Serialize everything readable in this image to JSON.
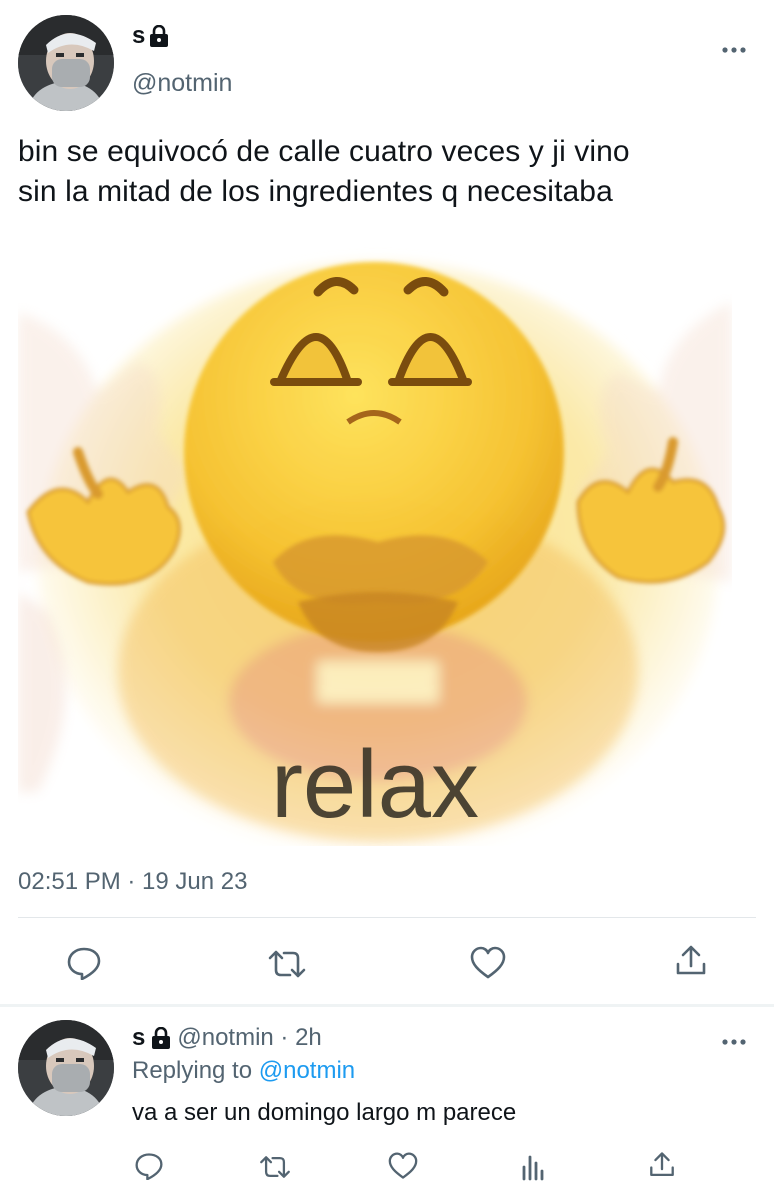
{
  "main_tweet": {
    "display_name": "s",
    "handle": "@notmin",
    "text_line1": "bin se equivocó de calle cuatro veces y ji vino",
    "text_line2": "sin la mitad de los ingredientes q necesitaba",
    "image_text": "relax",
    "timestamp": "02:51 PM · 19 Jun 23",
    "icons": {
      "lock": "lock-icon",
      "more": "more-icon",
      "reply": "reply-icon",
      "retweet": "retweet-icon",
      "like": "heart-icon",
      "share": "share-icon"
    }
  },
  "reply_tweet": {
    "display_name": "s",
    "handle_time": "@notmin · 2h",
    "replying_prefix": "Replying to",
    "replying_handle": "@notmin",
    "text": "va a ser un domingo largo m parece",
    "icons": {
      "lock": "lock-icon",
      "more": "more-icon",
      "reply": "reply-icon",
      "retweet": "retweet-icon",
      "like": "heart-icon",
      "analytics": "analytics-icon",
      "share": "share-icon"
    }
  },
  "colors": {
    "text": "#0f1419",
    "muted": "#536471",
    "link": "#1d9bf0",
    "divider": "#e3e7ea"
  }
}
